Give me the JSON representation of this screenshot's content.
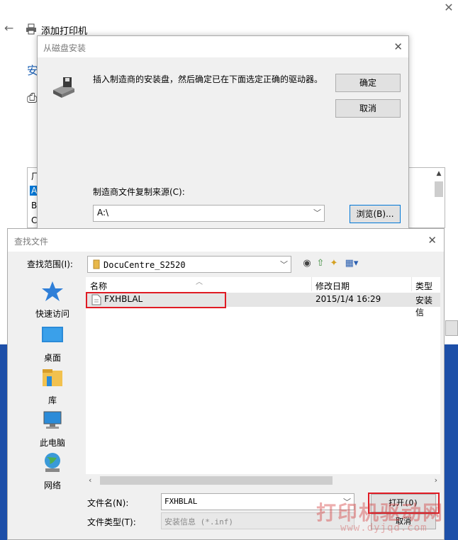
{
  "background_window": {
    "title": "添加打印机",
    "partial_heading": "安",
    "list_letters": [
      "厂",
      "A",
      "B",
      "C"
    ]
  },
  "disk_dialog": {
    "title": "从磁盘安装",
    "message": "插入制造商的安装盘，然后确定已在下面选定正确的驱动器。",
    "ok_label": "确定",
    "cancel_label": "取消",
    "copy_from_label": "制造商文件复制来源(C):",
    "copy_from_value": "A:\\",
    "browse_label": "浏览(B)..."
  },
  "find_dialog": {
    "title": "查找文件",
    "look_in_label": "查找范围(I):",
    "look_in_value": "DocuCentre_S2520",
    "places": [
      {
        "label": "快速访问",
        "icon": "star-icon"
      },
      {
        "label": "桌面",
        "icon": "desktop-icon"
      },
      {
        "label": "库",
        "icon": "library-icon"
      },
      {
        "label": "此电脑",
        "icon": "computer-icon"
      },
      {
        "label": "网络",
        "icon": "network-icon"
      }
    ],
    "columns": {
      "name": "名称",
      "modified": "修改日期",
      "type": "类型"
    },
    "files": [
      {
        "name": "FXHBLAL",
        "modified": "2015/1/4 16:29",
        "type": "安装信"
      }
    ],
    "file_name_label": "文件名(N):",
    "file_name_value": "FXHBLAL",
    "file_type_label": "文件类型(T):",
    "file_type_value": "安装信息 (*.inf)",
    "open_label": "打开(O)",
    "cancel_label": "取消"
  },
  "watermark": {
    "text": "打印机驱动网",
    "url": "www.dyjqd.com"
  },
  "colors": {
    "highlight_red": "#e01b24",
    "accent_blue": "#0078d7",
    "taskbar_blue": "#1d4fa8"
  }
}
